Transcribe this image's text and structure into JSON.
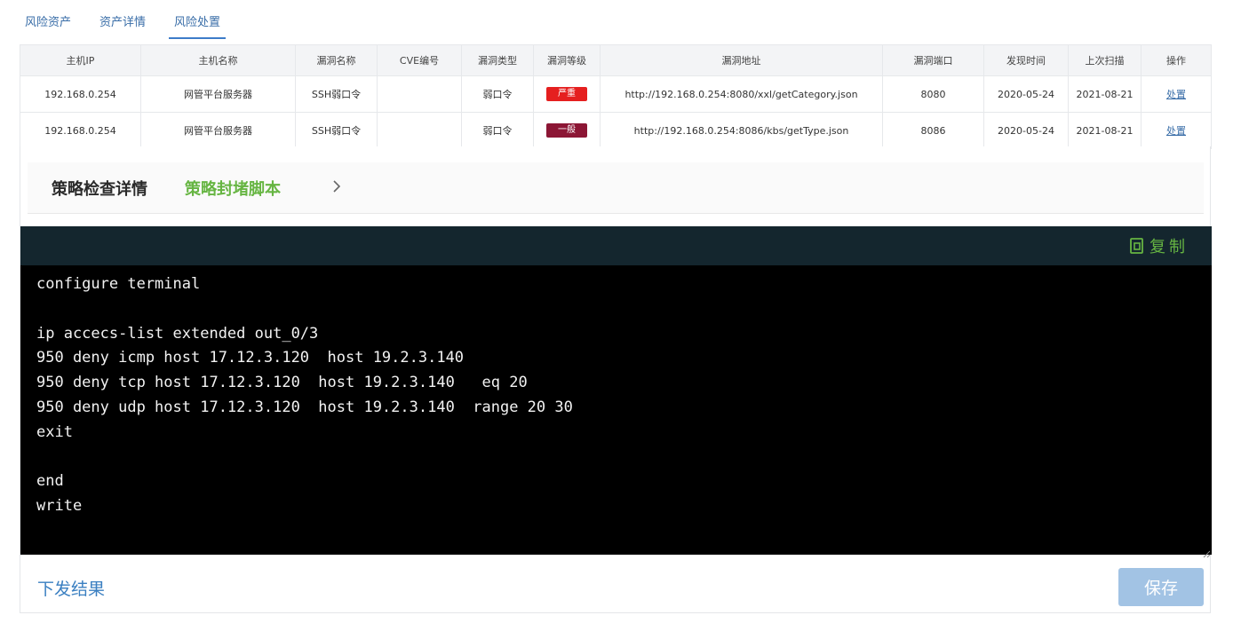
{
  "tabs": [
    {
      "label": "风险资产"
    },
    {
      "label": "资产详情"
    },
    {
      "label": "风险处置"
    }
  ],
  "table": {
    "headers": [
      "主机IP",
      "主机名称",
      "漏洞名称",
      "CVE编号",
      "漏洞类型",
      "漏洞等级",
      "漏洞地址",
      "漏洞端口",
      "发现时间",
      "上次扫描",
      "操作"
    ],
    "rows": [
      {
        "ip": "192.168.0.254",
        "host_name": "网管平台服务器",
        "vuln_name": "SSH弱口令",
        "cve": "",
        "vuln_type": "弱口令",
        "level": "严重",
        "level_color": "#e51f1f",
        "address": "http://192.168.0.254:8080/xxl/getCategory.json",
        "port": "8080",
        "found_time": "2020-05-24",
        "last_scan": "2021-08-21",
        "action": "处置"
      },
      {
        "ip": "192.168.0.254",
        "host_name": "网管平台服务器",
        "vuln_name": "SSH弱口令",
        "cve": "",
        "vuln_type": "弱口令",
        "level": "一般",
        "level_color": "#8c1635",
        "address": "http://192.168.0.254:8086/kbs/getType.json",
        "port": "8086",
        "found_time": "2020-05-24",
        "last_scan": "2021-08-21",
        "action": "处置"
      }
    ]
  },
  "panel": {
    "title": "策略检查详情",
    "script_label": "策略封堵脚本",
    "chevron_icon": "chevron-right-icon",
    "copy_icon": "copy-icon",
    "copy_label": "复制",
    "code_lines": [
      "configure terminal",
      "",
      "ip accecs-list extended out_0/3",
      "950 deny icmp host 17.12.3.120  host 19.2.3.140",
      "950 deny tcp host 17.12.3.120  host 19.2.3.140   eq 20",
      "950 deny udp host 17.12.3.120  host 19.2.3.140  range 20 30",
      "exit",
      "",
      "end",
      "write"
    ],
    "result_label": "下发结果",
    "save_label": "保存"
  },
  "colors": {
    "accent": "#3a6ea8",
    "green": "#66b542",
    "severe": "#e51f1f",
    "normal": "#8c1635",
    "save_disabled": "#a2c3e4",
    "code_toolbar": "#14262e"
  }
}
